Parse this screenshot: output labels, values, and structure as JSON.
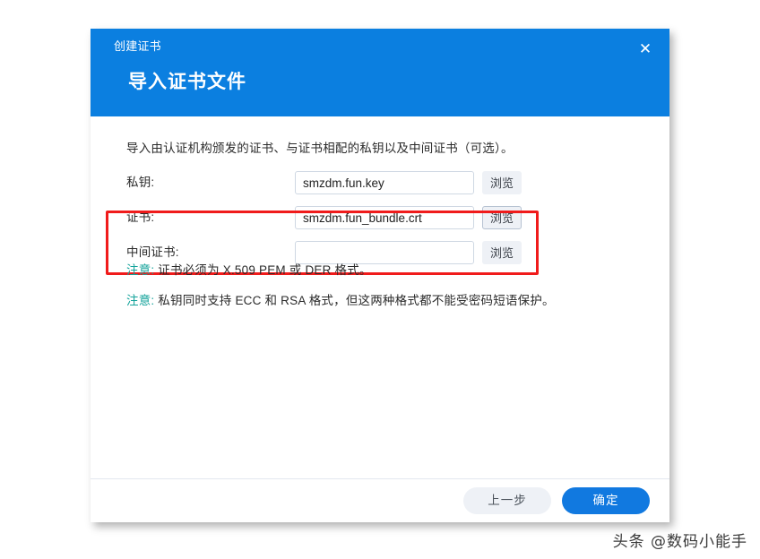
{
  "dialog": {
    "eyebrow": "创建证书",
    "title": "导入证书文件",
    "close_icon": "close-icon",
    "close_glyph": "✕",
    "intro": "导入由认证机构颁发的证书、与证书相配的私钥以及中间证书（可选）。",
    "header_color": "#0b7fe0"
  },
  "form": {
    "rows": [
      {
        "label": "私钥:",
        "value": "smzdm.fun.key",
        "placeholder": "",
        "browse_label": "浏览",
        "browse_focused": false,
        "highlighted": true
      },
      {
        "label": "证书:",
        "value": "smzdm.fun_bundle.crt",
        "placeholder": "",
        "browse_label": "浏览",
        "browse_focused": true,
        "highlighted": true
      },
      {
        "label": "中间证书:",
        "value": "",
        "placeholder": "",
        "browse_label": "浏览",
        "browse_focused": false,
        "highlighted": false
      }
    ]
  },
  "highlight": {
    "color": "#f01b1b"
  },
  "notices": [
    {
      "tag": "注意:",
      "text": " 证书必须为 X.509 PEM 或 DER 格式。"
    },
    {
      "tag": "注意:",
      "text": " 私钥同时支持 ECC 和 RSA 格式，但这两种格式都不能受密码短语保护。"
    }
  ],
  "notice_color": "#14a39b",
  "footer": {
    "back_label": "上一步",
    "confirm_label": "确定",
    "confirm_color": "#1179e0"
  },
  "watermark": {
    "text": "头条 @数码小能手"
  }
}
